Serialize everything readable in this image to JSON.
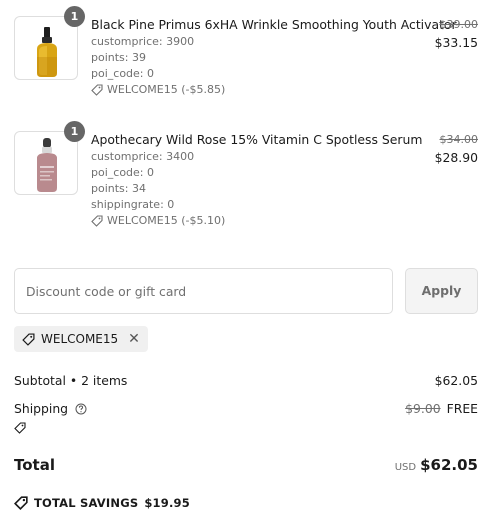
{
  "line_items": [
    {
      "quantity": "1",
      "name": "Black Pine Primus 6xHA Wrinkle Smoothing Youth Activator",
      "properties": [
        "customprice: 3900",
        "points: 39",
        "poi_code: 0"
      ],
      "discount": "WELCOME15 (-$5.85)",
      "compare_price": "$39.00",
      "price": "$33.15",
      "thumbnail_icon": "gold-serum-dropper-bottle"
    },
    {
      "quantity": "1",
      "name": "Apothecary Wild Rose 15% Vitamin C Spotless Serum",
      "properties": [
        "customprice: 3400",
        "poi_code: 0",
        "points: 34",
        "shippingrate: 0"
      ],
      "discount": "WELCOME15 (-$5.10)",
      "compare_price": "$34.00",
      "price": "$28.90",
      "thumbnail_icon": "pink-serum-dropper-bottle"
    }
  ],
  "discount_form": {
    "placeholder": "Discount code or gift card",
    "value": "",
    "apply_label": "Apply"
  },
  "applied_code": {
    "code": "WELCOME15"
  },
  "summary": {
    "subtotal_label": "Subtotal • 2 items",
    "subtotal_value": "$62.05",
    "shipping_label": "Shipping",
    "shipping_old": "$9.00",
    "shipping_value": "FREE",
    "total_label": "Total",
    "currency": "USD",
    "total_value": "$62.05",
    "savings_label": "TOTAL SAVINGS",
    "savings_value": "$19.95"
  },
  "colors": {
    "badge": "#666666",
    "muted_text": "#707070",
    "border": "#dedede",
    "chip_bg": "#f0f0f0"
  }
}
